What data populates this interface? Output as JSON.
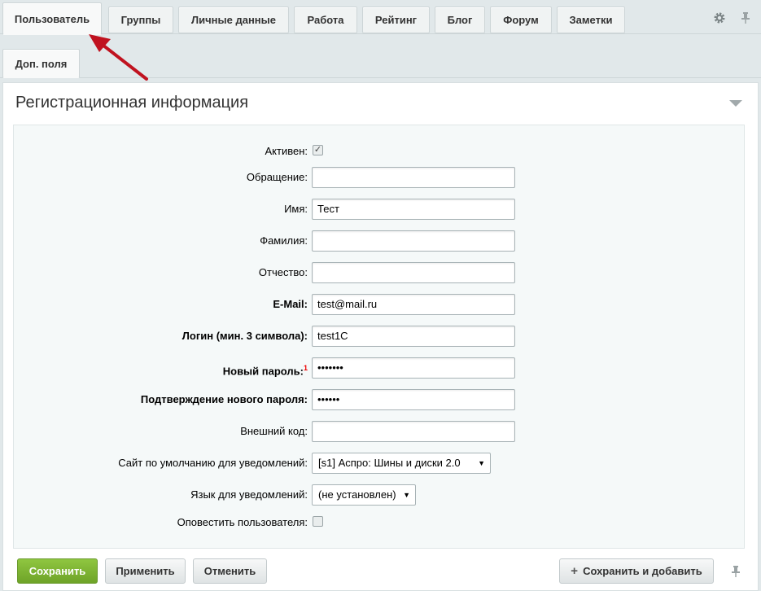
{
  "tabs": {
    "row1": [
      "Пользователь",
      "Группы",
      "Личные данные",
      "Работа",
      "Рейтинг",
      "Блог",
      "Форум",
      "Заметки"
    ],
    "row2": [
      "Доп. поля"
    ],
    "active": "Пользователь"
  },
  "section": {
    "title": "Регистрационная информация"
  },
  "form": {
    "active_label": "Активен:",
    "active_checked": true,
    "salutation_label": "Обращение:",
    "salutation_value": "",
    "first_name_label": "Имя:",
    "first_name_value": "Тест",
    "last_name_label": "Фамилия:",
    "last_name_value": "",
    "middle_name_label": "Отчество:",
    "middle_name_value": "",
    "email_label": "E-Mail:",
    "email_value": "test@mail.ru",
    "login_label": "Логин (мин. 3 символа):",
    "login_value": "test1C",
    "new_password_label": "Новый пароль:",
    "new_password_note": "1",
    "new_password_value": "•••••••",
    "confirm_password_label": "Подтверждение нового пароля:",
    "confirm_password_value": "••••••",
    "external_code_label": "Внешний код:",
    "external_code_value": "",
    "site_label": "Сайт по умолчанию для уведомлений:",
    "site_value": "[s1] Аспро: Шины и диски 2.0",
    "language_label": "Язык для уведомлений:",
    "language_value": "(не установлен)",
    "notify_label": "Оповестить пользователя:",
    "notify_checked": false
  },
  "buttons": {
    "save": "Сохранить",
    "apply": "Применить",
    "cancel": "Отменить",
    "save_and_add": "Сохранить и добавить"
  },
  "colors": {
    "primary_button": "#7ab232",
    "annotation_arrow": "#c0121f",
    "required_mark": "#e00000"
  },
  "icons": [
    "gear-icon",
    "pin-icon",
    "collapse-triangle-icon",
    "plus-icon",
    "checkmark-icon",
    "dropdown-caret-icon"
  ]
}
